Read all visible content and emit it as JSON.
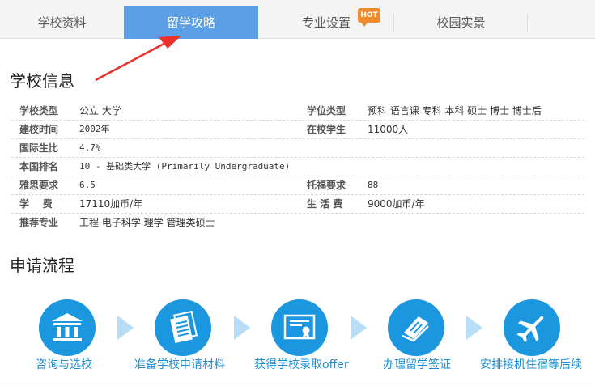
{
  "tabs": [
    {
      "label": "学校资料"
    },
    {
      "label": "留学攻略"
    },
    {
      "label": "专业设置"
    },
    {
      "label": "校园实景"
    }
  ],
  "hot_badge": "HOT",
  "school_info": {
    "title": "学校信息",
    "rows": [
      {
        "label": "学校类型",
        "value": "公立 大学",
        "label2": "学位类型",
        "value2": "预科 语言课 专科 本科 硕士 博士 博士后"
      },
      {
        "label": "建校时间",
        "value": "2002年",
        "label2": "在校学生",
        "value2": "11000人"
      },
      {
        "label": "国际生比",
        "value": "4.7%"
      },
      {
        "label": "本国排名",
        "value": "10 - 基础类大学 (Primarily Undergraduate)"
      },
      {
        "label": "雅思要求",
        "value": "6.5",
        "label2": "托福要求",
        "value2": "88"
      },
      {
        "label": "学    费",
        "value": "17110加币/年",
        "label2": "生 活 费",
        "value2": "9000加币/年"
      },
      {
        "label": "推荐专业",
        "value": "工程 电子科学 理学 管理类硕士"
      }
    ]
  },
  "process": {
    "title": "申请流程",
    "steps": [
      {
        "label": "咨询与选校",
        "icon": "university-icon"
      },
      {
        "label": "准备学校申请材料",
        "icon": "documents-icon"
      },
      {
        "label": "获得学校录取offer",
        "icon": "certificate-icon"
      },
      {
        "label": "办理留学签证",
        "icon": "passport-icon"
      },
      {
        "label": "安排接机住宿等后续",
        "icon": "airplane-icon"
      }
    ]
  },
  "colors": {
    "tab_active": "#5b9fe7",
    "hot": "#f08b2c",
    "step_circle": "#1a97df",
    "step_label": "#1a8fd6",
    "arrow": "#e8322b"
  }
}
